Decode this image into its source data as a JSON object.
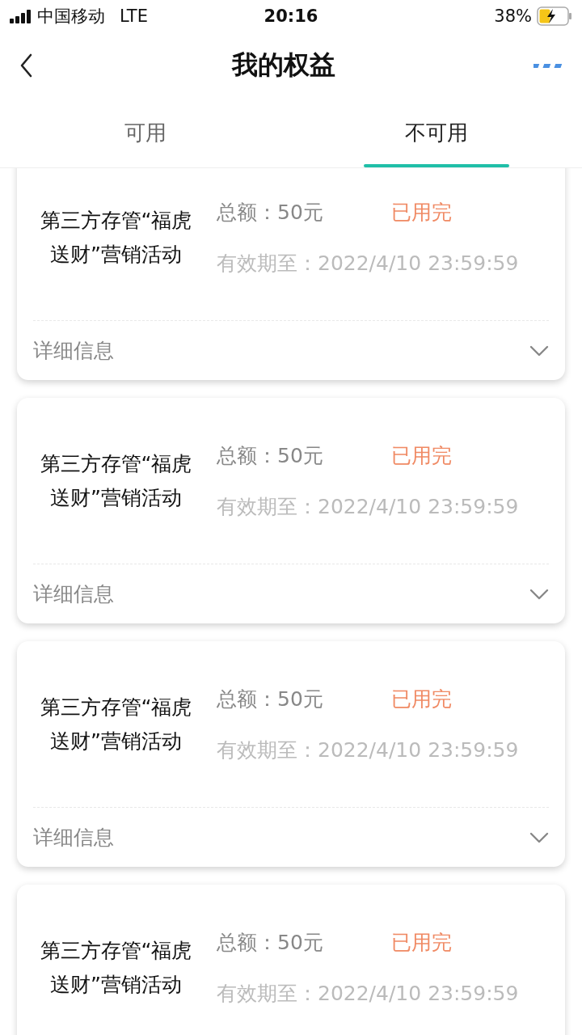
{
  "status_bar": {
    "carrier": "中国移动",
    "network": "LTE",
    "time": "20:16",
    "battery": "38%",
    "charging": true
  },
  "header": {
    "title": "我的权益"
  },
  "tabs": [
    {
      "label": "可用",
      "selected": false
    },
    {
      "label": "不可用",
      "selected": true
    }
  ],
  "cards": [
    {
      "title": "第三方存管“福虎送财”营销活动",
      "amount": "总额：50元",
      "status": "已用完",
      "expiry": "有效期至：2022/4/10 23:59:59",
      "detail_label": "详细信息"
    },
    {
      "title": "第三方存管“福虎送财”营销活动",
      "amount": "总额：50元",
      "status": "已用完",
      "expiry": "有效期至：2022/4/10 23:59:59",
      "detail_label": "详细信息"
    },
    {
      "title": "第三方存管“福虎送财”营销活动",
      "amount": "总额：50元",
      "status": "已用完",
      "expiry": "有效期至：2022/4/10 23:59:59",
      "detail_label": "详细信息"
    },
    {
      "title": "第三方存管“福虎送财”营销活动",
      "amount": "总额：50元",
      "status": "已用完",
      "expiry": "有效期至：2022/4/10 23:59:59"
    }
  ]
}
